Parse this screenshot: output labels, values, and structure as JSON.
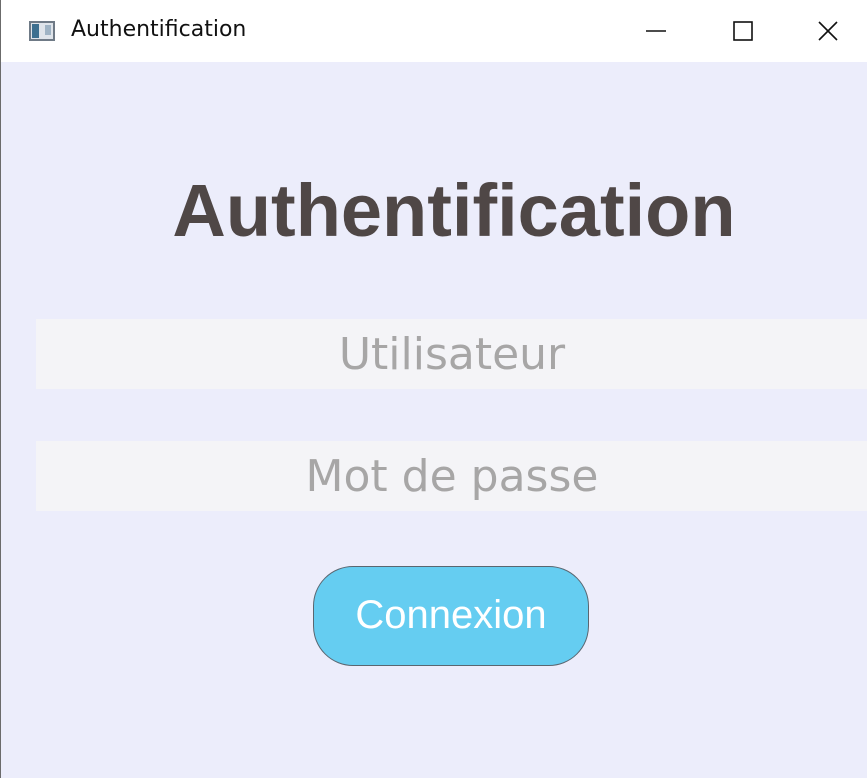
{
  "window": {
    "title": "Authentification",
    "app_icon": "app-window-icon",
    "controls": [
      "minimize-icon",
      "maximize-icon",
      "close-icon"
    ]
  },
  "form": {
    "heading": "Authentification",
    "username_placeholder": "Utilisateur",
    "username_value": "",
    "password_placeholder": "Mot de passe",
    "password_value": "",
    "submit_label": "Connexion"
  },
  "colors": {
    "background": "#ecedfb",
    "field_background": "#f4f4f7",
    "heading": "#4f4746",
    "placeholder": "#a7a6a6",
    "button": "#65cdf1",
    "button_text": "#ffffff"
  }
}
